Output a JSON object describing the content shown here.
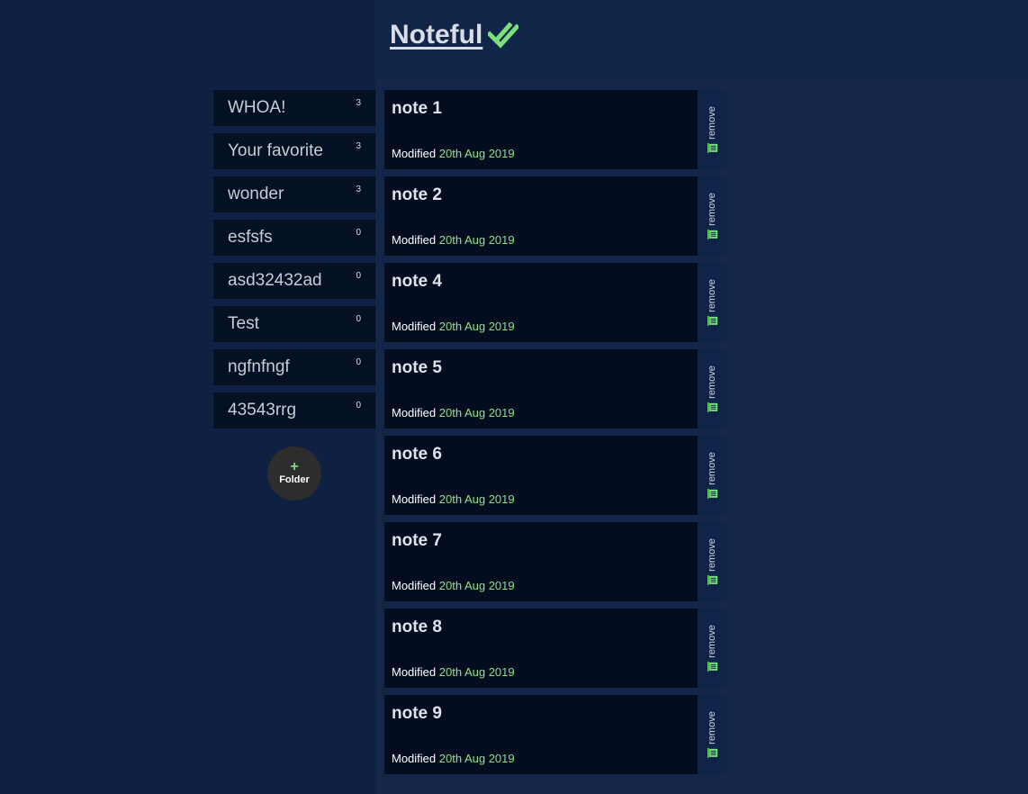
{
  "header": {
    "title": "Noteful",
    "check_icon": "double-check-icon",
    "accent": "#7be07b"
  },
  "sidebar": {
    "folders": [
      {
        "name": "WHOA!",
        "count": "3"
      },
      {
        "name": "Your favorite",
        "count": "3"
      },
      {
        "name": "wonder",
        "count": "3"
      },
      {
        "name": "esfsfs",
        "count": "0"
      },
      {
        "name": "asd32432ad",
        "count": "0"
      },
      {
        "name": "Test",
        "count": "0"
      },
      {
        "name": "ngfnfngf",
        "count": "0"
      },
      {
        "name": "43543rrg",
        "count": "0"
      }
    ],
    "add_folder": {
      "plus": "+",
      "label": "Folder"
    }
  },
  "notes": [
    {
      "title": "note 1",
      "modified_label": "Modified",
      "date": "20th Aug 2019",
      "remove_label": "remove"
    },
    {
      "title": "note 2",
      "modified_label": "Modified",
      "date": "20th Aug 2019",
      "remove_label": "remove"
    },
    {
      "title": "note 4",
      "modified_label": "Modified",
      "date": "20th Aug 2019",
      "remove_label": "remove"
    },
    {
      "title": "note 5",
      "modified_label": "Modified",
      "date": "20th Aug 2019",
      "remove_label": "remove"
    },
    {
      "title": "note 6",
      "modified_label": "Modified",
      "date": "20th Aug 2019",
      "remove_label": "remove"
    },
    {
      "title": "note 7",
      "modified_label": "Modified",
      "date": "20th Aug 2019",
      "remove_label": "remove"
    },
    {
      "title": "note 8",
      "modified_label": "Modified",
      "date": "20th Aug 2019",
      "remove_label": "remove"
    },
    {
      "title": "note 9",
      "modified_label": "Modified",
      "date": "20th Aug 2019",
      "remove_label": "remove"
    }
  ]
}
